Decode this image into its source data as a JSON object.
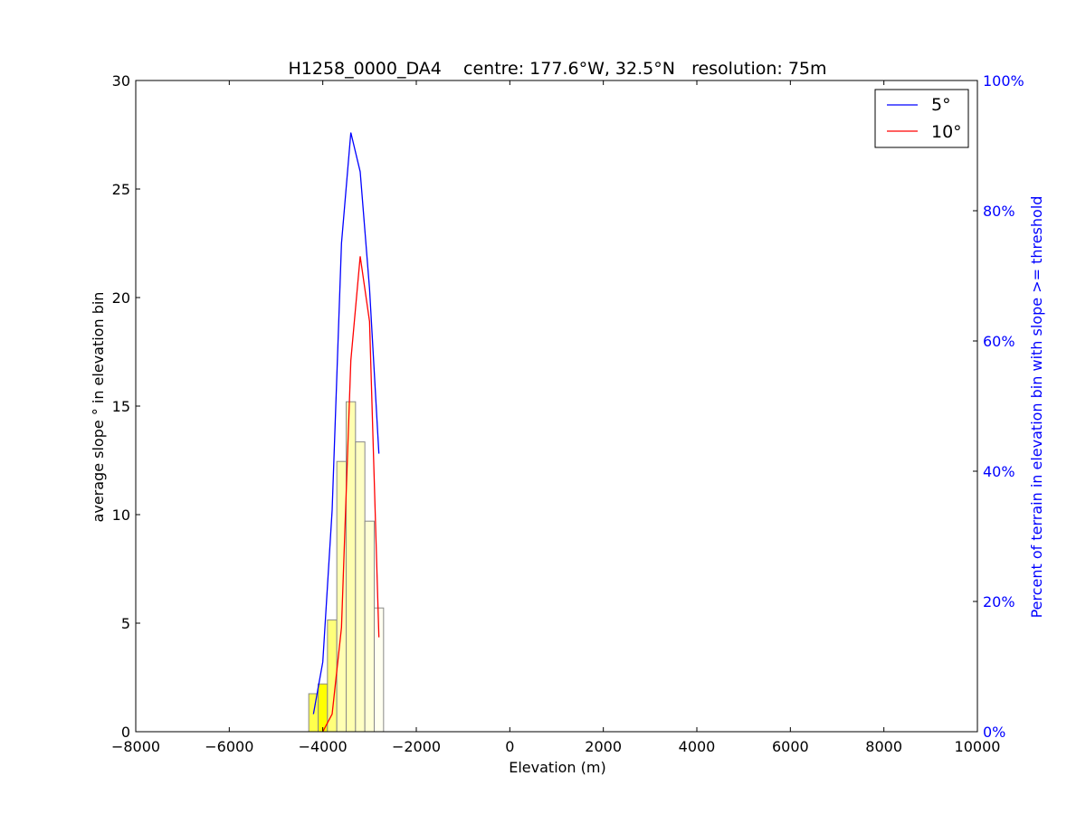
{
  "chart_data": {
    "type": "bar+line",
    "title": "H1258_0000_DA4    centre: 177.6°W, 32.5°N   resolution: 75m",
    "xlabel": "Elevation (m)",
    "ylabel": "average slope ° in elevation bin",
    "ylabel_right": "Percent of terrain in elevation bin with slope >= threshold",
    "xlim": [
      -8000,
      10000
    ],
    "ylim": [
      0,
      30
    ],
    "ylim_right": [
      0,
      100
    ],
    "x_ticks": [
      "−8000",
      "−6000",
      "−4000",
      "−2000",
      "0",
      "2000",
      "4000",
      "6000",
      "8000",
      "10000"
    ],
    "x_tick_values": [
      -8000,
      -6000,
      -4000,
      -2000,
      0,
      2000,
      4000,
      6000,
      8000,
      10000
    ],
    "y_ticks": [
      "0",
      "5",
      "10",
      "15",
      "20",
      "25",
      "30"
    ],
    "y_tick_values": [
      0,
      5,
      10,
      15,
      20,
      25,
      30
    ],
    "y_right_ticks": [
      "0%",
      "20%",
      "40%",
      "60%",
      "80%",
      "100%"
    ],
    "y_right_tick_values": [
      0,
      20,
      40,
      60,
      80,
      100
    ],
    "grid": false,
    "legend_position": "top-right",
    "bars": {
      "bin_width": 200,
      "left_edges": [
        -4300,
        -4100,
        -3900,
        -3700,
        -3500,
        -3300,
        -3100,
        -2900,
        -2700
      ],
      "values": [
        1.75,
        2.2,
        5.15,
        12.45,
        15.2,
        13.35,
        9.7,
        5.7,
        0
      ],
      "fill_colors": [
        "#ffff4d",
        "#ffff00",
        "#ffff7a",
        "#ffffb3",
        "#ffffb0",
        "#ffffc4",
        "#ffffd6",
        "#fffff0",
        "#ffffff"
      ]
    },
    "series": [
      {
        "name": "5°",
        "color": "#0000ff",
        "x": [
          -4200,
          -4000,
          -3800,
          -3600,
          -3400,
          -3200,
          -3000,
          -2800
        ],
        "y_percent": [
          2.7,
          10.7,
          34,
          75,
          92,
          86,
          68,
          42.7
        ]
      },
      {
        "name": "10°",
        "color": "#ff0000",
        "x": [
          -4000,
          -3800,
          -3600,
          -3400,
          -3200,
          -3000,
          -2800
        ],
        "y_percent": [
          0,
          2.7,
          16,
          57,
          73,
          63,
          14.5
        ]
      }
    ]
  }
}
